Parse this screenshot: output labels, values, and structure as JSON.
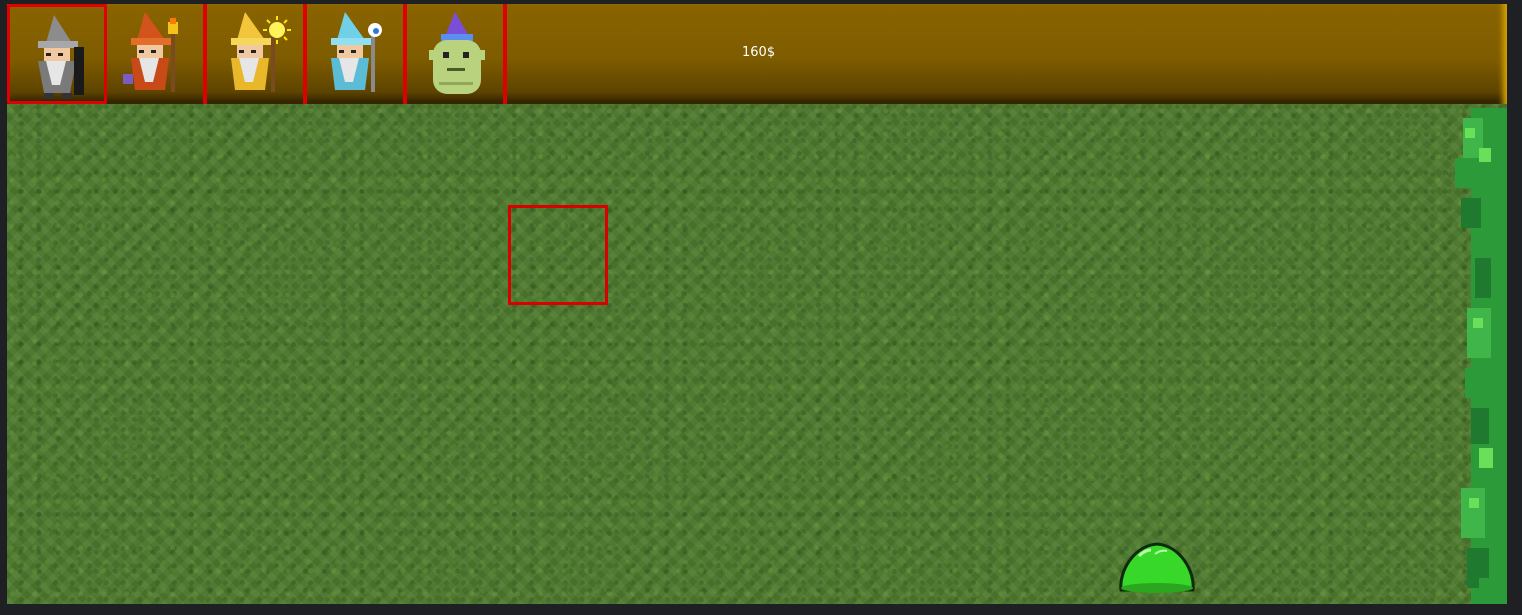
{
  "hud": {
    "money": "160$",
    "units": [
      {
        "name": "gray-wizard",
        "selected": true
      },
      {
        "name": "fire-wizard",
        "selected": false
      },
      {
        "name": "light-wizard",
        "selected": false
      },
      {
        "name": "ice-wizard",
        "selected": false
      },
      {
        "name": "goblin-wizard",
        "selected": false
      }
    ]
  },
  "colors": {
    "bar": "#7e5c00",
    "selection": "#e00000",
    "grass": "#4d7a2e",
    "slime": "#33cc22"
  }
}
